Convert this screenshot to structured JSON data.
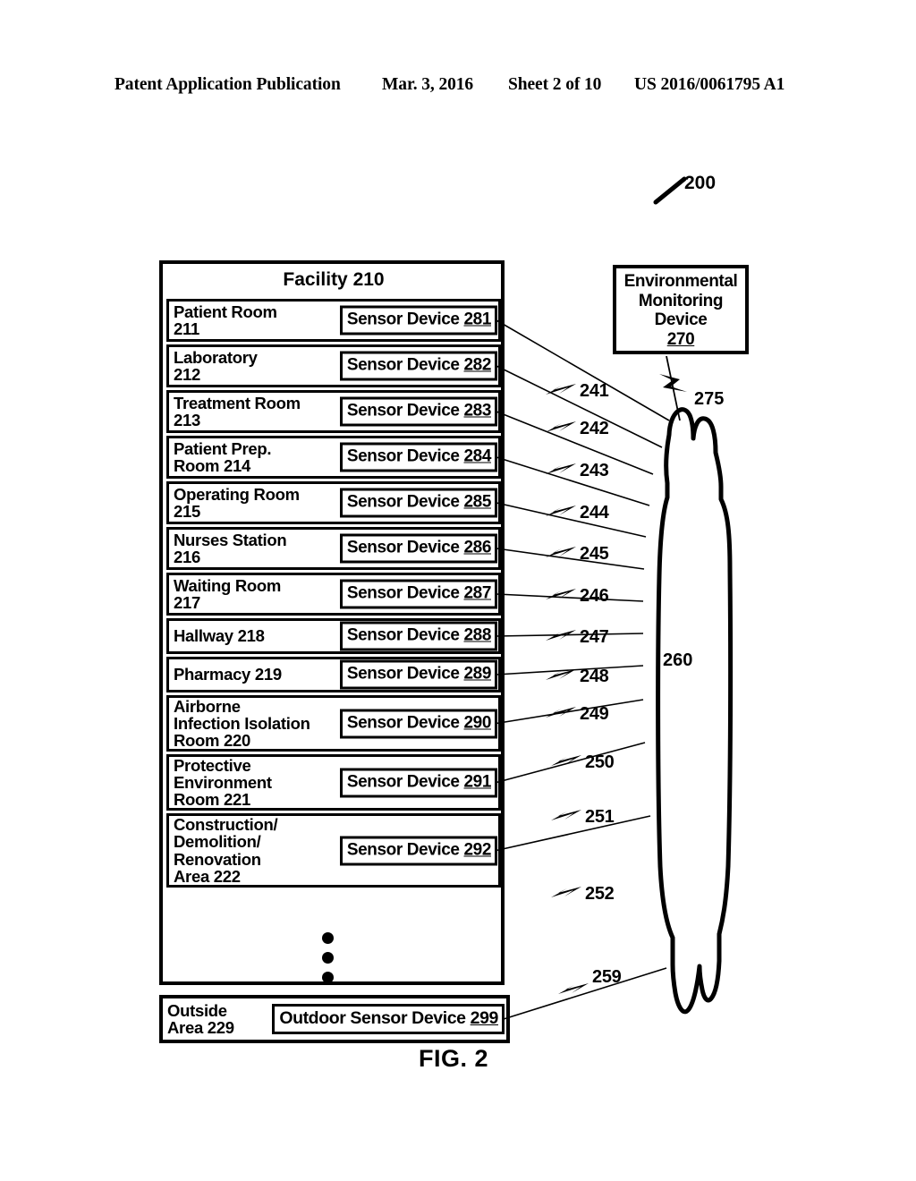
{
  "header": {
    "publication": "Patent Application Publication",
    "date": "Mar. 3, 2016",
    "sheet": "Sheet 2 of 10",
    "number": "US 2016/0061795 A1"
  },
  "figure": {
    "caption": "FIG. 2",
    "system_ref": "200"
  },
  "facility": {
    "title": "Facility 210",
    "rooms": [
      {
        "name": "Patient Room\n211",
        "name_plain": "Patient Room",
        "ref": "211",
        "sensor_label": "Sensor Device ",
        "sensor_ref": "281",
        "conn_ref": "241"
      },
      {
        "name": "Laboratory\n212",
        "name_plain": "Laboratory",
        "ref": "212",
        "sensor_label": "Sensor Device ",
        "sensor_ref": "282",
        "conn_ref": "242"
      },
      {
        "name": "Treatment Room\n213",
        "name_plain": "Treatment Room",
        "ref": "213",
        "sensor_label": "Sensor Device ",
        "sensor_ref": "283",
        "conn_ref": "243"
      },
      {
        "name": "Patient Prep.\nRoom 214",
        "name_plain": "Patient Prep. Room",
        "ref": "214",
        "sensor_label": "Sensor Device ",
        "sensor_ref": "284",
        "conn_ref": "244"
      },
      {
        "name": "Operating Room\n215",
        "name_plain": "Operating Room",
        "ref": "215",
        "sensor_label": "Sensor Device ",
        "sensor_ref": "285",
        "conn_ref": "245"
      },
      {
        "name": "Nurses Station\n216",
        "name_plain": "Nurses Station",
        "ref": "216",
        "sensor_label": "Sensor Device ",
        "sensor_ref": "286",
        "conn_ref": "246"
      },
      {
        "name": "Waiting Room\n217",
        "name_plain": "Waiting Room",
        "ref": "217",
        "sensor_label": "Sensor Device ",
        "sensor_ref": "287",
        "conn_ref": "247"
      },
      {
        "name": "Hallway 218",
        "name_plain": "Hallway",
        "ref": "218",
        "sensor_label": "Sensor Device ",
        "sensor_ref": "288",
        "conn_ref": "248"
      },
      {
        "name": "Pharmacy 219",
        "name_plain": "Pharmacy",
        "ref": "219",
        "sensor_label": "Sensor Device ",
        "sensor_ref": "289",
        "conn_ref": "249"
      },
      {
        "name": "Airborne\nInfection Isolation\nRoom 220",
        "name_plain": "Airborne Infection Isolation Room",
        "ref": "220",
        "sensor_label": "Sensor Device ",
        "sensor_ref": "290",
        "conn_ref": "250"
      },
      {
        "name": "Protective\nEnvironment\nRoom 221",
        "name_plain": "Protective Environment Room",
        "ref": "221",
        "sensor_label": "Sensor Device ",
        "sensor_ref": "291",
        "conn_ref": "251"
      },
      {
        "name": "Construction/\nDemolition/\nRenovation\nArea 222",
        "name_plain": "Construction/Demolition/Renovation Area",
        "ref": "222",
        "sensor_label": "Sensor Device ",
        "sensor_ref": "292",
        "conn_ref": "252"
      }
    ],
    "ellipsis": "● ● ●"
  },
  "outside": {
    "name": "Outside\nArea 229",
    "name_plain": "Outside Area",
    "ref": "229",
    "sensor_label": "Outdoor Sensor Device ",
    "sensor_ref": "299",
    "conn_ref": "259"
  },
  "monitoring_device": {
    "line1": "Environmental",
    "line2": "Monitoring",
    "line3": "Device",
    "ref": "270",
    "link_ref": "275"
  },
  "network": {
    "ref": "260"
  },
  "colors": {
    "ink": "#000000",
    "paper": "#ffffff"
  }
}
